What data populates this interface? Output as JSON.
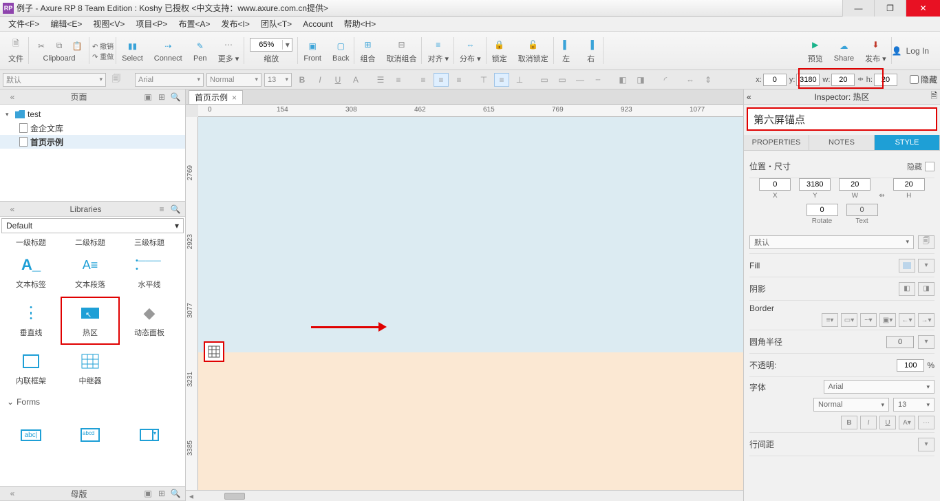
{
  "titlebar": {
    "app_icon_text": "RP",
    "title": "例子 - Axure RP 8 Team Edition : Koshy 已授权   <中文支持：www.axure.com.cn提供>"
  },
  "menus": [
    "文件<F>",
    "编辑<E>",
    "视图<V>",
    "项目<P>",
    "布置<A>",
    "发布<I>",
    "团队<T>",
    "Account",
    "帮助<H>"
  ],
  "toolbar": {
    "file_label": "文件",
    "clipboard_label": "Clipboard",
    "undo_label": "撤销",
    "redo_label": "重做",
    "select_label": "Select",
    "connect_label": "Connect",
    "pen_label": "Pen",
    "more_label": "更多 ▾",
    "zoom_value": "65%",
    "zoom_label": "缩放",
    "front_label": "Front",
    "back_label": "Back",
    "group_label": "组合",
    "ungroup_label": "取消组合",
    "align_label": "对齐 ▾",
    "distribute_label": "分布 ▾",
    "lock_label": "锁定",
    "unlock_label": "取消锁定",
    "left_label": "左",
    "right_label": "右",
    "preview_label": "预览",
    "share_label": "Share",
    "publish_label": "发布 ▾",
    "login_label": "Log In"
  },
  "toolbar2": {
    "style_preset": "默认",
    "font": "Arial",
    "weight": "Normal",
    "size": "13",
    "x_label": "x:",
    "x_val": "0",
    "y_label": "y:",
    "y_val": "3180",
    "w_label": "w:",
    "w_val": "20",
    "h_label": "h:",
    "h_val": "20",
    "hide_label": "隐藏"
  },
  "left": {
    "pages_title": "页面",
    "tree": {
      "root": "test",
      "item1": "金企文库",
      "item2": "首页示例"
    },
    "libraries_title": "Libraries",
    "lib_selected": "Default",
    "row0": [
      "一级标题",
      "二级标题",
      "三级标题"
    ],
    "row1": [
      "文本标签",
      "文本段落",
      "水平线"
    ],
    "row2": [
      "垂直线",
      "热区",
      "动态面板"
    ],
    "row3": [
      "内联框架",
      "中继器",
      ""
    ],
    "forms_hdr": "Forms",
    "masters_title": "母版"
  },
  "center": {
    "tab_label": "首页示例",
    "ruler_h": [
      "0",
      "154",
      "308",
      "462",
      "615",
      "769",
      "923",
      "1077"
    ],
    "ruler_v": [
      "2769",
      "2923",
      "3077",
      "3231",
      "3385"
    ]
  },
  "inspector": {
    "header": "Inspector: 热区",
    "name_value": "第六屏锚点",
    "tab_props": "PROPERTIES",
    "tab_notes": "NOTES",
    "tab_style": "STYLE",
    "pos_label": "位置・尺寸",
    "hide_label": "隐藏",
    "x": "0",
    "y": "3180",
    "w": "20",
    "h": "20",
    "x_l": "X",
    "y_l": "Y",
    "w_l": "W",
    "h_l": "H",
    "rotate": "0",
    "rotate_l": "Rotate",
    "text_angle": "0",
    "text_l": "Text",
    "style_preset": "默认",
    "fill_l": "Fill",
    "shadow_l": "阴影",
    "border_l": "Border",
    "radius_l": "圆角半径",
    "radius_v": "0",
    "opacity_l": "不透明:",
    "opacity_v": "100",
    "opacity_pct": "%",
    "font_l": "字体",
    "font_v": "Arial",
    "weight_v": "Normal",
    "size_v": "13",
    "line_h_l": "行间距"
  }
}
